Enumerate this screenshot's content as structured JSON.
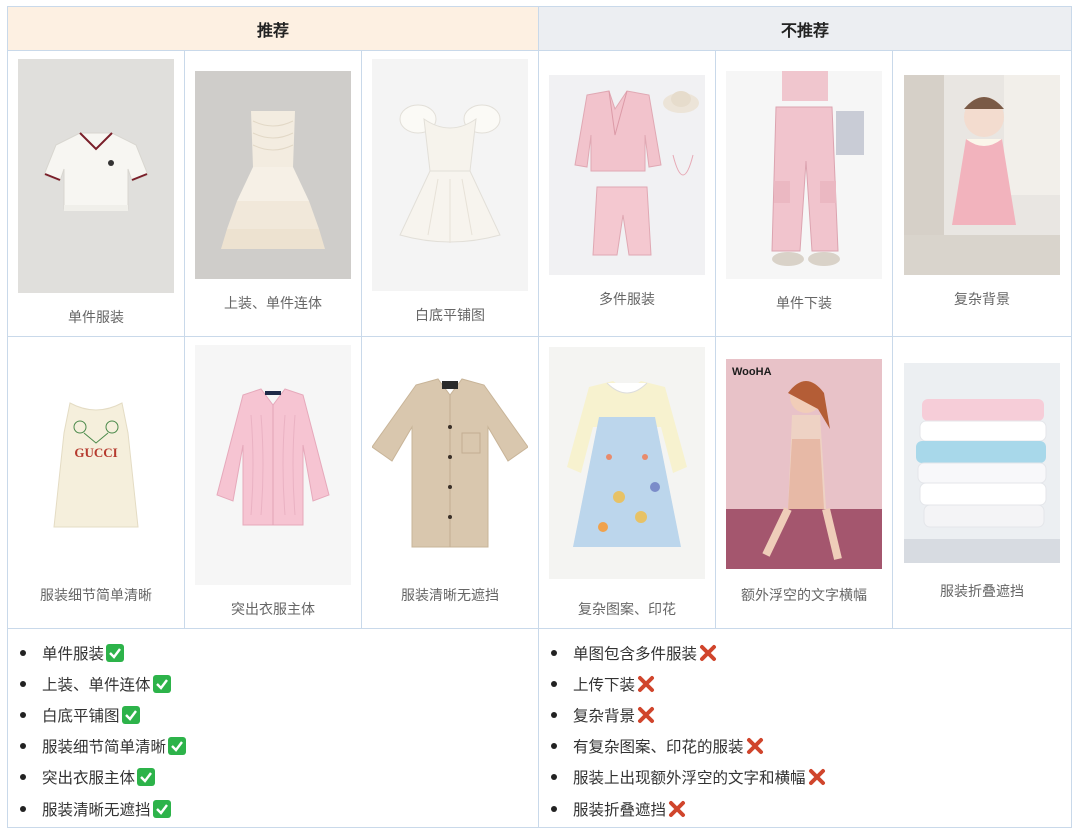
{
  "header": {
    "recommended": "推荐",
    "not_recommended": "不推荐"
  },
  "examples": {
    "row1": [
      {
        "caption": "单件服装",
        "icon": "polo-shirt-photo"
      },
      {
        "caption": "上装、单件连体",
        "icon": "strapless-dress-photo"
      },
      {
        "caption": "白底平铺图",
        "icon": "puff-sleeve-dress-photo"
      },
      {
        "caption": "多件服装",
        "icon": "pink-suit-set-photo"
      },
      {
        "caption": "单件下装",
        "icon": "pink-cargo-pants-photo"
      },
      {
        "caption": "复杂背景",
        "icon": "child-pink-dress-photo"
      }
    ],
    "row2": [
      {
        "caption": "服装细节简单清晰",
        "icon": "gucci-tank-dress-photo",
        "logo_text": "GUCCI"
      },
      {
        "caption": "突出衣服主体",
        "icon": "pink-cardigan-photo"
      },
      {
        "caption": "服装清晰无遮挡",
        "icon": "beige-shirt-photo"
      },
      {
        "caption": "复杂图案、印花",
        "icon": "printed-kids-dress-photo"
      },
      {
        "caption": "额外浮空的文字横幅",
        "icon": "model-poster-photo",
        "logo_text": "WooHA"
      },
      {
        "caption": "服装折叠遮挡",
        "icon": "folded-tshirts-photo"
      }
    ]
  },
  "recommended_list": [
    "单件服装",
    "上装、单件连体",
    "白底平铺图",
    "服装细节简单清晰",
    "突出衣服主体",
    "服装清晰无遮挡"
  ],
  "not_recommended_list": [
    "单图包含多件服装",
    "上传下装",
    "复杂背景",
    "有复杂图案、印花的服装",
    "服装上出现额外浮空的文字和横幅",
    "服装折叠遮挡"
  ],
  "colors": {
    "recommended_header_bg": "#fdf0e2",
    "not_recommended_header_bg": "#eceef2",
    "border": "#c9d9ea",
    "check_green": "#2db34a",
    "cross_red": "#d0452c"
  }
}
